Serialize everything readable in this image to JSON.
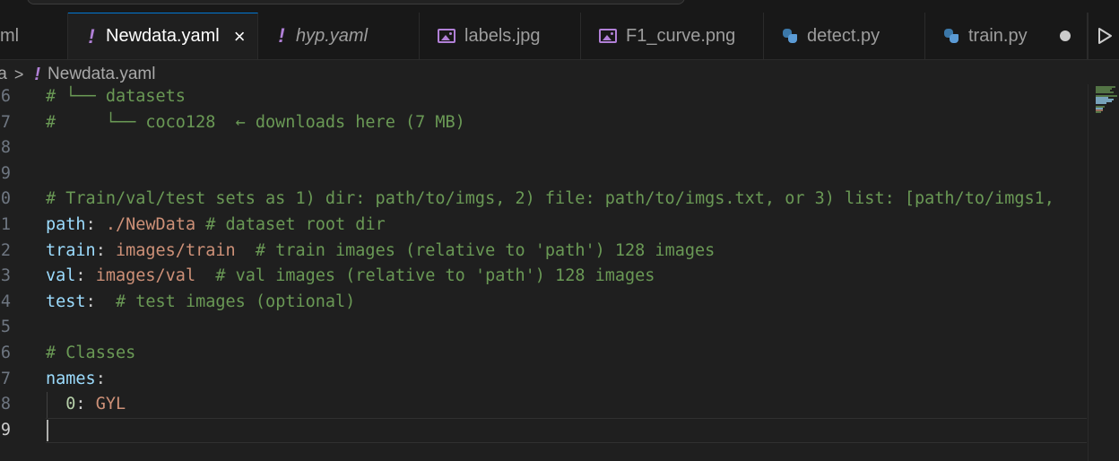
{
  "tabs": [
    {
      "label": "ml",
      "icon": "yaml-icon",
      "type": "partial"
    },
    {
      "label": "Newdata.yaml",
      "icon": "yaml-icon",
      "active": true,
      "close": "×"
    },
    {
      "label": "hyp.yaml",
      "icon": "yaml-icon",
      "italic": true
    },
    {
      "label": "labels.jpg",
      "icon": "image-icon"
    },
    {
      "label": "F1_curve.png",
      "icon": "image-icon"
    },
    {
      "label": "detect.py",
      "icon": "python-icon"
    },
    {
      "label": "train.py",
      "icon": "python-icon",
      "modified": true
    }
  ],
  "breadcrumb": {
    "segment": "ta",
    "separator": ">",
    "file_icon": "!",
    "file": "Newdata.yaml"
  },
  "editor": {
    "lines": [
      {
        "n": "6",
        "parts": [
          {
            "t": "# └── datasets",
            "c": "cm"
          }
        ]
      },
      {
        "n": "7",
        "parts": [
          {
            "t": "#     └── coco128  ← downloads here (7 MB)",
            "c": "cm"
          }
        ]
      },
      {
        "n": "8",
        "parts": []
      },
      {
        "n": "9",
        "parts": []
      },
      {
        "n": "0",
        "parts": [
          {
            "t": "# Train/val/test sets as 1) dir: path/to/imgs, 2) file: path/to/imgs.txt, or 3) list: [path/to/imgs1,",
            "c": "cm"
          }
        ]
      },
      {
        "n": "1",
        "parts": [
          {
            "t": "path",
            "c": "key"
          },
          {
            "t": ": ",
            "c": "punc"
          },
          {
            "t": "./NewData",
            "c": "str"
          },
          {
            "t": " # dataset root dir",
            "c": "cm"
          }
        ]
      },
      {
        "n": "2",
        "parts": [
          {
            "t": "train",
            "c": "key"
          },
          {
            "t": ": ",
            "c": "punc"
          },
          {
            "t": "images/train",
            "c": "str"
          },
          {
            "t": "  # train images (relative to 'path') 128 images",
            "c": "cm"
          }
        ]
      },
      {
        "n": "3",
        "parts": [
          {
            "t": "val",
            "c": "key"
          },
          {
            "t": ": ",
            "c": "punc"
          },
          {
            "t": "images/val",
            "c": "str"
          },
          {
            "t": "  # val images (relative to 'path') 128 images",
            "c": "cm"
          }
        ]
      },
      {
        "n": "4",
        "parts": [
          {
            "t": "test",
            "c": "key"
          },
          {
            "t": ":  ",
            "c": "punc"
          },
          {
            "t": "# test images (optional)",
            "c": "cm"
          }
        ]
      },
      {
        "n": "5",
        "parts": []
      },
      {
        "n": "6",
        "parts": [
          {
            "t": "# Classes",
            "c": "cm"
          }
        ]
      },
      {
        "n": "7",
        "parts": [
          {
            "t": "names",
            "c": "key"
          },
          {
            "t": ":",
            "c": "punc"
          }
        ]
      },
      {
        "n": "8",
        "parts": [
          {
            "t": "  ",
            "c": "punc"
          },
          {
            "t": "0",
            "c": "num"
          },
          {
            "t": ": ",
            "c": "punc"
          },
          {
            "t": "GYL",
            "c": "str"
          }
        ]
      },
      {
        "n": "9",
        "parts": [],
        "current": true
      }
    ]
  }
}
